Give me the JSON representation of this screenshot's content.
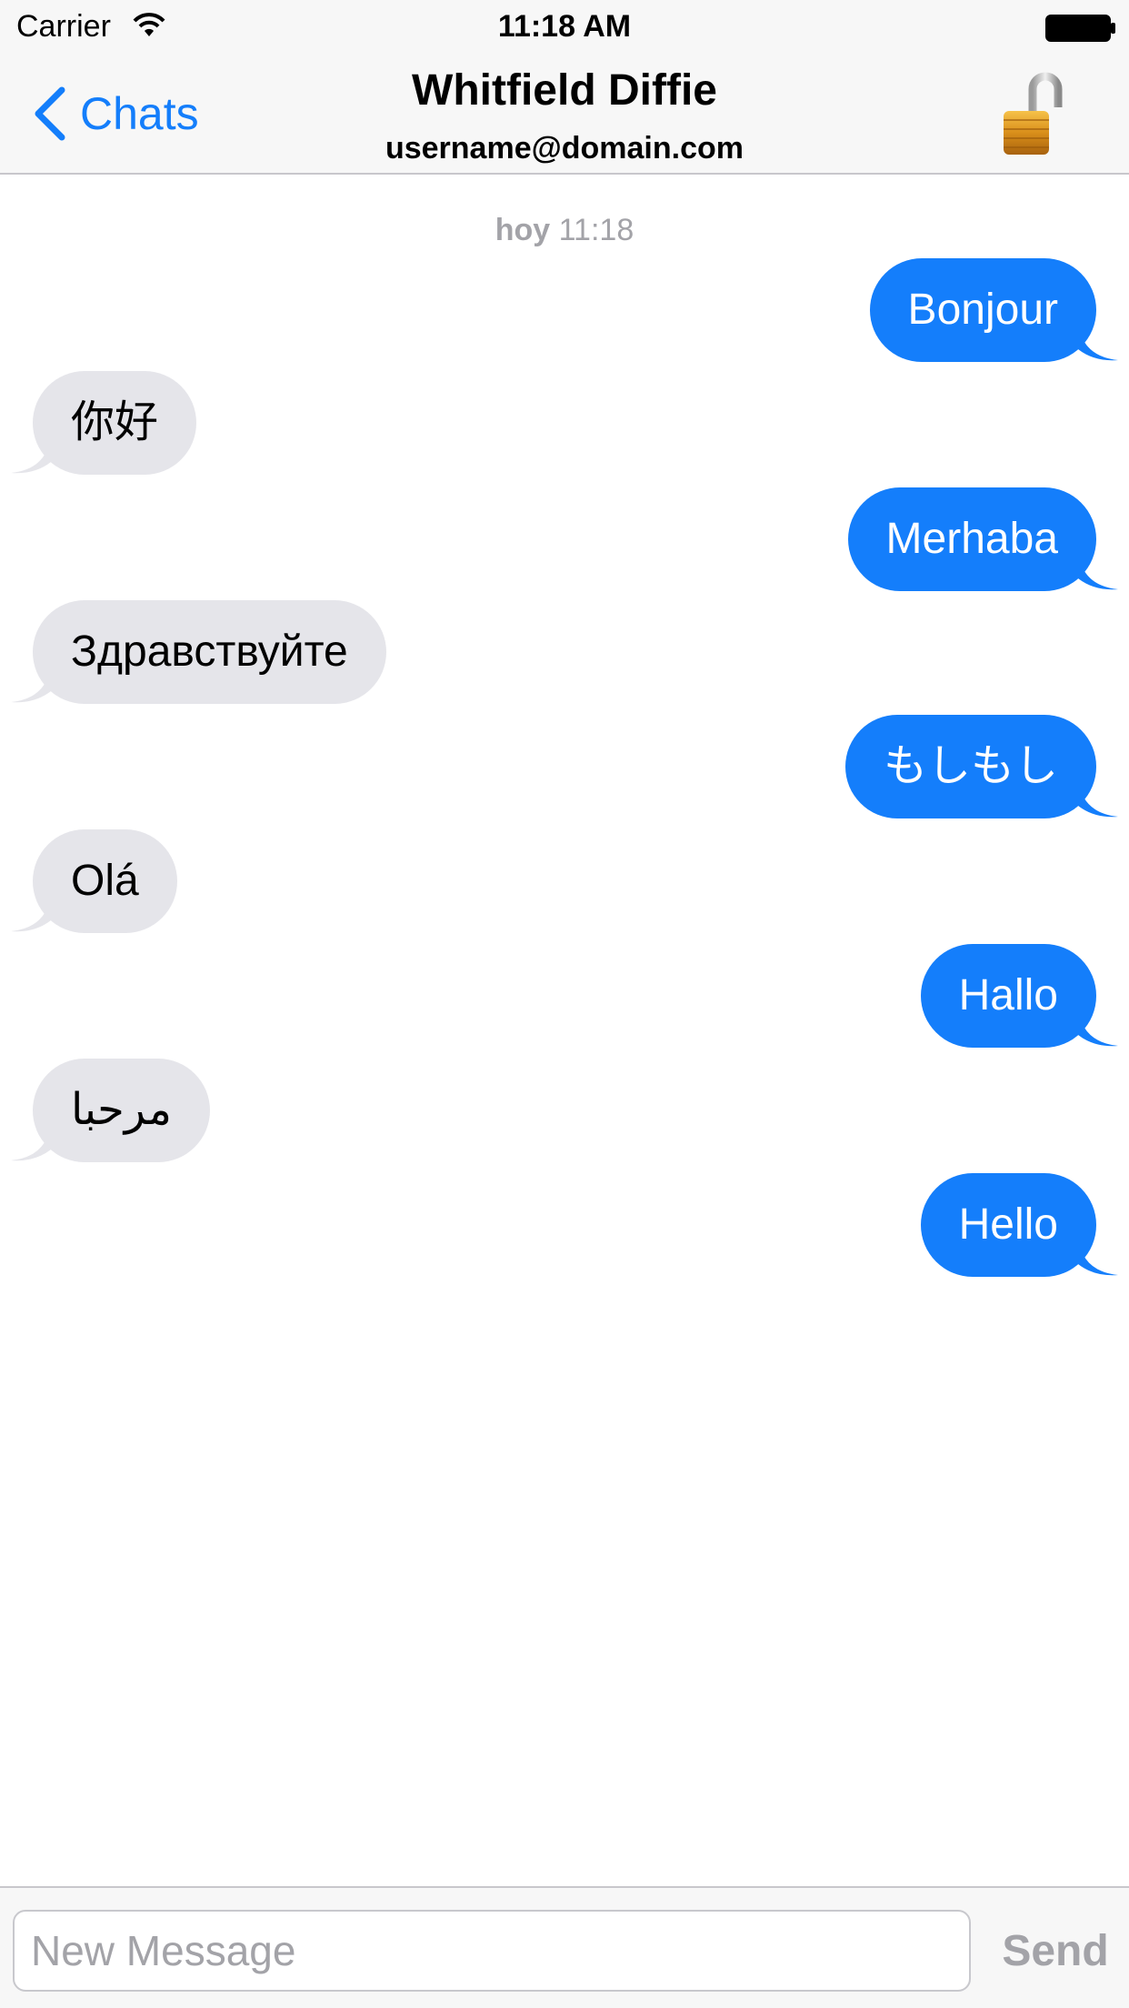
{
  "status_bar": {
    "carrier": "Carrier",
    "time": "11:18 AM"
  },
  "nav": {
    "back_label": "Chats",
    "contact_name": "Whitfield Diffie",
    "contact_address": "username@domain.com",
    "lock_icon": "open-padlock-icon"
  },
  "thread": {
    "timestamp_day": "hoy",
    "timestamp_time": "11:18",
    "messages": [
      {
        "direction": "outgoing",
        "text": "Bonjour"
      },
      {
        "direction": "incoming",
        "text": "你好"
      },
      {
        "direction": "outgoing",
        "text": "Merhaba"
      },
      {
        "direction": "incoming",
        "text": "Здравствуйте"
      },
      {
        "direction": "outgoing",
        "text": "もしもし"
      },
      {
        "direction": "incoming",
        "text": "Olá"
      },
      {
        "direction": "outgoing",
        "text": "Hallo"
      },
      {
        "direction": "incoming",
        "text": "مرحبا"
      },
      {
        "direction": "outgoing",
        "text": "Hello"
      }
    ]
  },
  "composer": {
    "placeholder": "New Message",
    "value": "",
    "send_label": "Send"
  },
  "colors": {
    "accent": "#147efb",
    "incoming_bubble": "#e5e5ea",
    "muted_text": "#a3a3a8"
  }
}
